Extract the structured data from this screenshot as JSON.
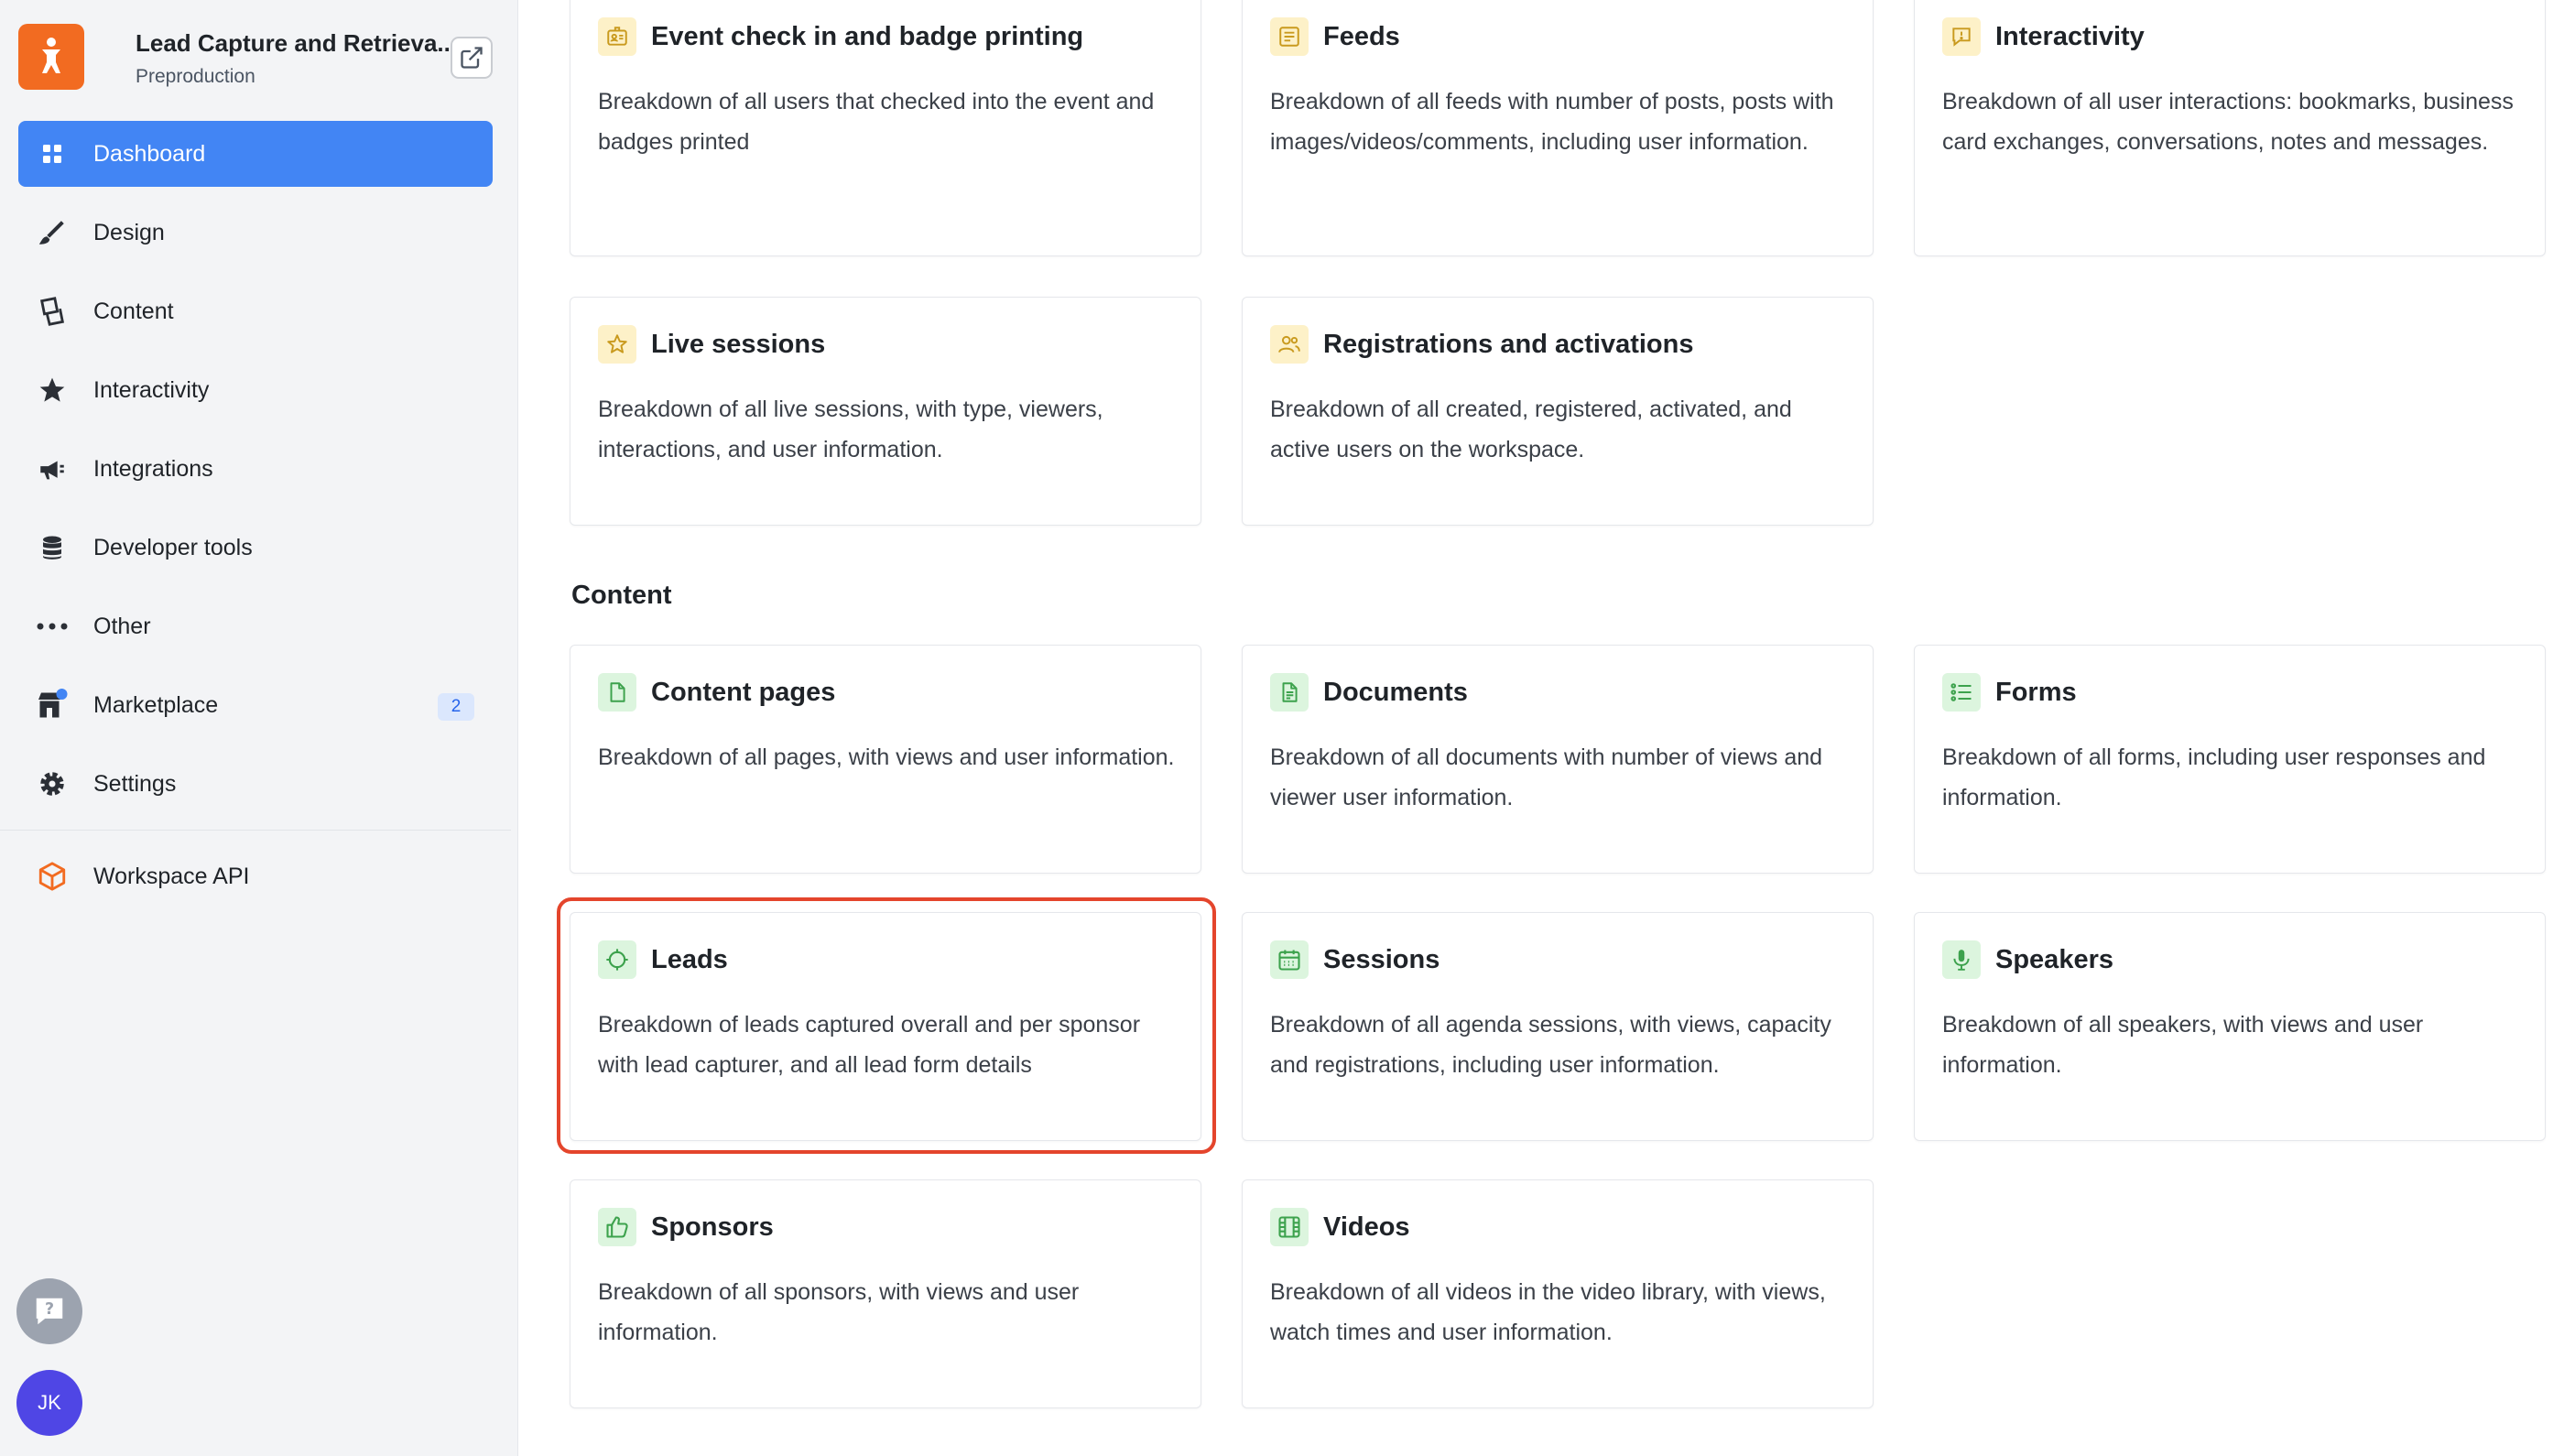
{
  "workspace": {
    "title": "Lead Capture and Retrieva...",
    "subtitle": "Preproduction"
  },
  "sidebar": {
    "items": [
      {
        "label": "Dashboard",
        "icon": "grid-icon",
        "active": true
      },
      {
        "label": "Design",
        "icon": "brush-icon"
      },
      {
        "label": "Content",
        "icon": "content-icon"
      },
      {
        "label": "Interactivity",
        "icon": "star-icon"
      },
      {
        "label": "Integrations",
        "icon": "megaphone-icon"
      },
      {
        "label": "Developer tools",
        "icon": "database-icon"
      },
      {
        "label": "Other",
        "icon": "more-icon"
      },
      {
        "label": "Marketplace",
        "icon": "store-icon",
        "badge": "2"
      },
      {
        "label": "Settings",
        "icon": "gear-icon"
      }
    ],
    "api": {
      "label": "Workspace API",
      "icon": "cube-icon"
    },
    "user_initials": "JK"
  },
  "sections": {
    "content_title": "Content"
  },
  "cards": {
    "event_checkin": {
      "title": "Event check in and badge printing",
      "desc": "Breakdown of all users that checked into the event and badges printed"
    },
    "feeds": {
      "title": "Feeds",
      "desc": "Breakdown of all feeds with number of posts, posts with images/videos/comments, including user information."
    },
    "interactivity": {
      "title": "Interactivity",
      "desc": "Breakdown of all user interactions: bookmarks, business card exchanges, conversations, notes and messages."
    },
    "live_sessions": {
      "title": "Live sessions",
      "desc": "Breakdown of all live sessions, with type, viewers, interactions, and user information."
    },
    "registrations": {
      "title": "Registrations and activations",
      "desc": "Breakdown of all created, registered, activated, and active users on the workspace."
    },
    "content_pages": {
      "title": "Content pages",
      "desc": "Breakdown of all pages, with views and user information."
    },
    "documents": {
      "title": "Documents",
      "desc": "Breakdown of all documents with number of views and viewer user information."
    },
    "forms": {
      "title": "Forms",
      "desc": "Breakdown of all forms, including user responses and information."
    },
    "leads": {
      "title": "Leads",
      "desc": "Breakdown of leads captured overall and per sponsor with lead capturer, and all lead form details"
    },
    "sessions": {
      "title": "Sessions",
      "desc": "Breakdown of all agenda sessions, with views, capacity and registrations, including user information."
    },
    "speakers": {
      "title": "Speakers",
      "desc": "Breakdown of all speakers, with views and user information."
    },
    "sponsors": {
      "title": "Sponsors",
      "desc": "Breakdown of all sponsors, with views and user information."
    },
    "videos": {
      "title": "Videos",
      "desc": "Breakdown of all videos in the video library, with views, watch times and user information."
    }
  },
  "colors": {
    "accent": "#4285f4",
    "brand": "#f26b21",
    "highlight": "#e4452c",
    "icon_yellow_bg": "#fdf1c8",
    "icon_green_bg": "#dcf5de"
  }
}
